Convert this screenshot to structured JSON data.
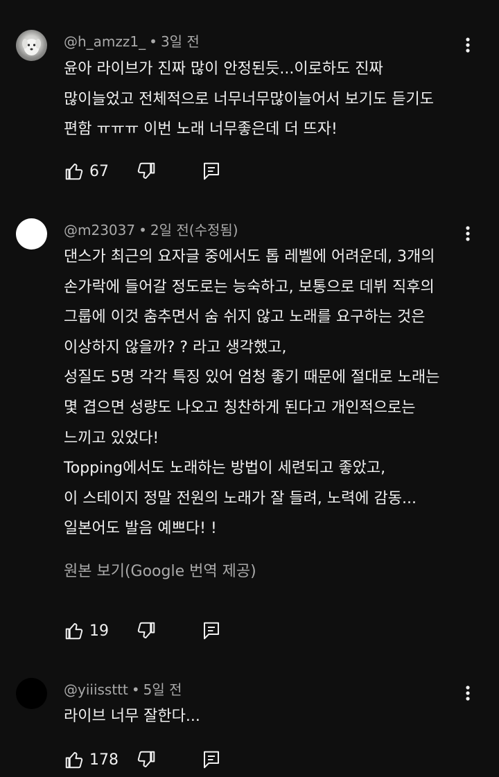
{
  "comments": [
    {
      "author": "@h_amzz1_",
      "time": "3일 전",
      "text_lines": [
        "윤아 라이브가 진짜 많이 안정된듯...이로하도 진짜",
        "많이늘었고 전체적으로 너무너무많이늘어서 보기도 듣기도",
        "편함 ㅠㅠㅠ 이번 노래 너무좋은데 더 뜨자!"
      ],
      "likes": "67",
      "avatar_icon": "dog-avatar"
    },
    {
      "author": "@m23037",
      "time": "2일 전(수정됨)",
      "text_lines": [
        "댄스가 최근의 요자글 중에서도 톱 레벨에 어려운데, 3개의",
        "손가락에 들어갈 정도로는 능숙하고, 보통으로 데뷔 직후의",
        "그룹에 이것 춤추면서 숨 쉬지 않고 노래를 요구하는 것은",
        "이상하지 않을까? ? 라고 생각했고,",
        "성질도 5명 각각 특징 있어 엄청 좋기 때문에 절대로 노래는",
        "몇 겹으면 성량도 나오고 칭찬하게 된다고 개인적으로는",
        "느끼고 있었다!",
        "Topping에서도 노래하는 방법이 세련되고 좋았고,",
        "이 스테이지 정말 전원의 노래가 잘 들려, 노력에 감동...",
        "일본어도 발음 예쁘다! !"
      ],
      "translate_label": "원본 보기(Google 번역 제공)",
      "likes": "19",
      "avatar_icon": "white-avatar"
    },
    {
      "author": "@yiiissttt",
      "time": "5일 전",
      "text_lines": [
        "라이브 너무 잘한다..."
      ],
      "likes": "178",
      "avatar_icon": "black-avatar"
    }
  ],
  "icons": {
    "like": "thumbs-up-icon",
    "dislike": "thumbs-down-icon",
    "reply": "reply-icon",
    "more": "more-vert-icon"
  },
  "colors": {
    "background": "#0f0f0f",
    "text": "#f1f1f1",
    "secondary_text": "#aaaaaa"
  }
}
